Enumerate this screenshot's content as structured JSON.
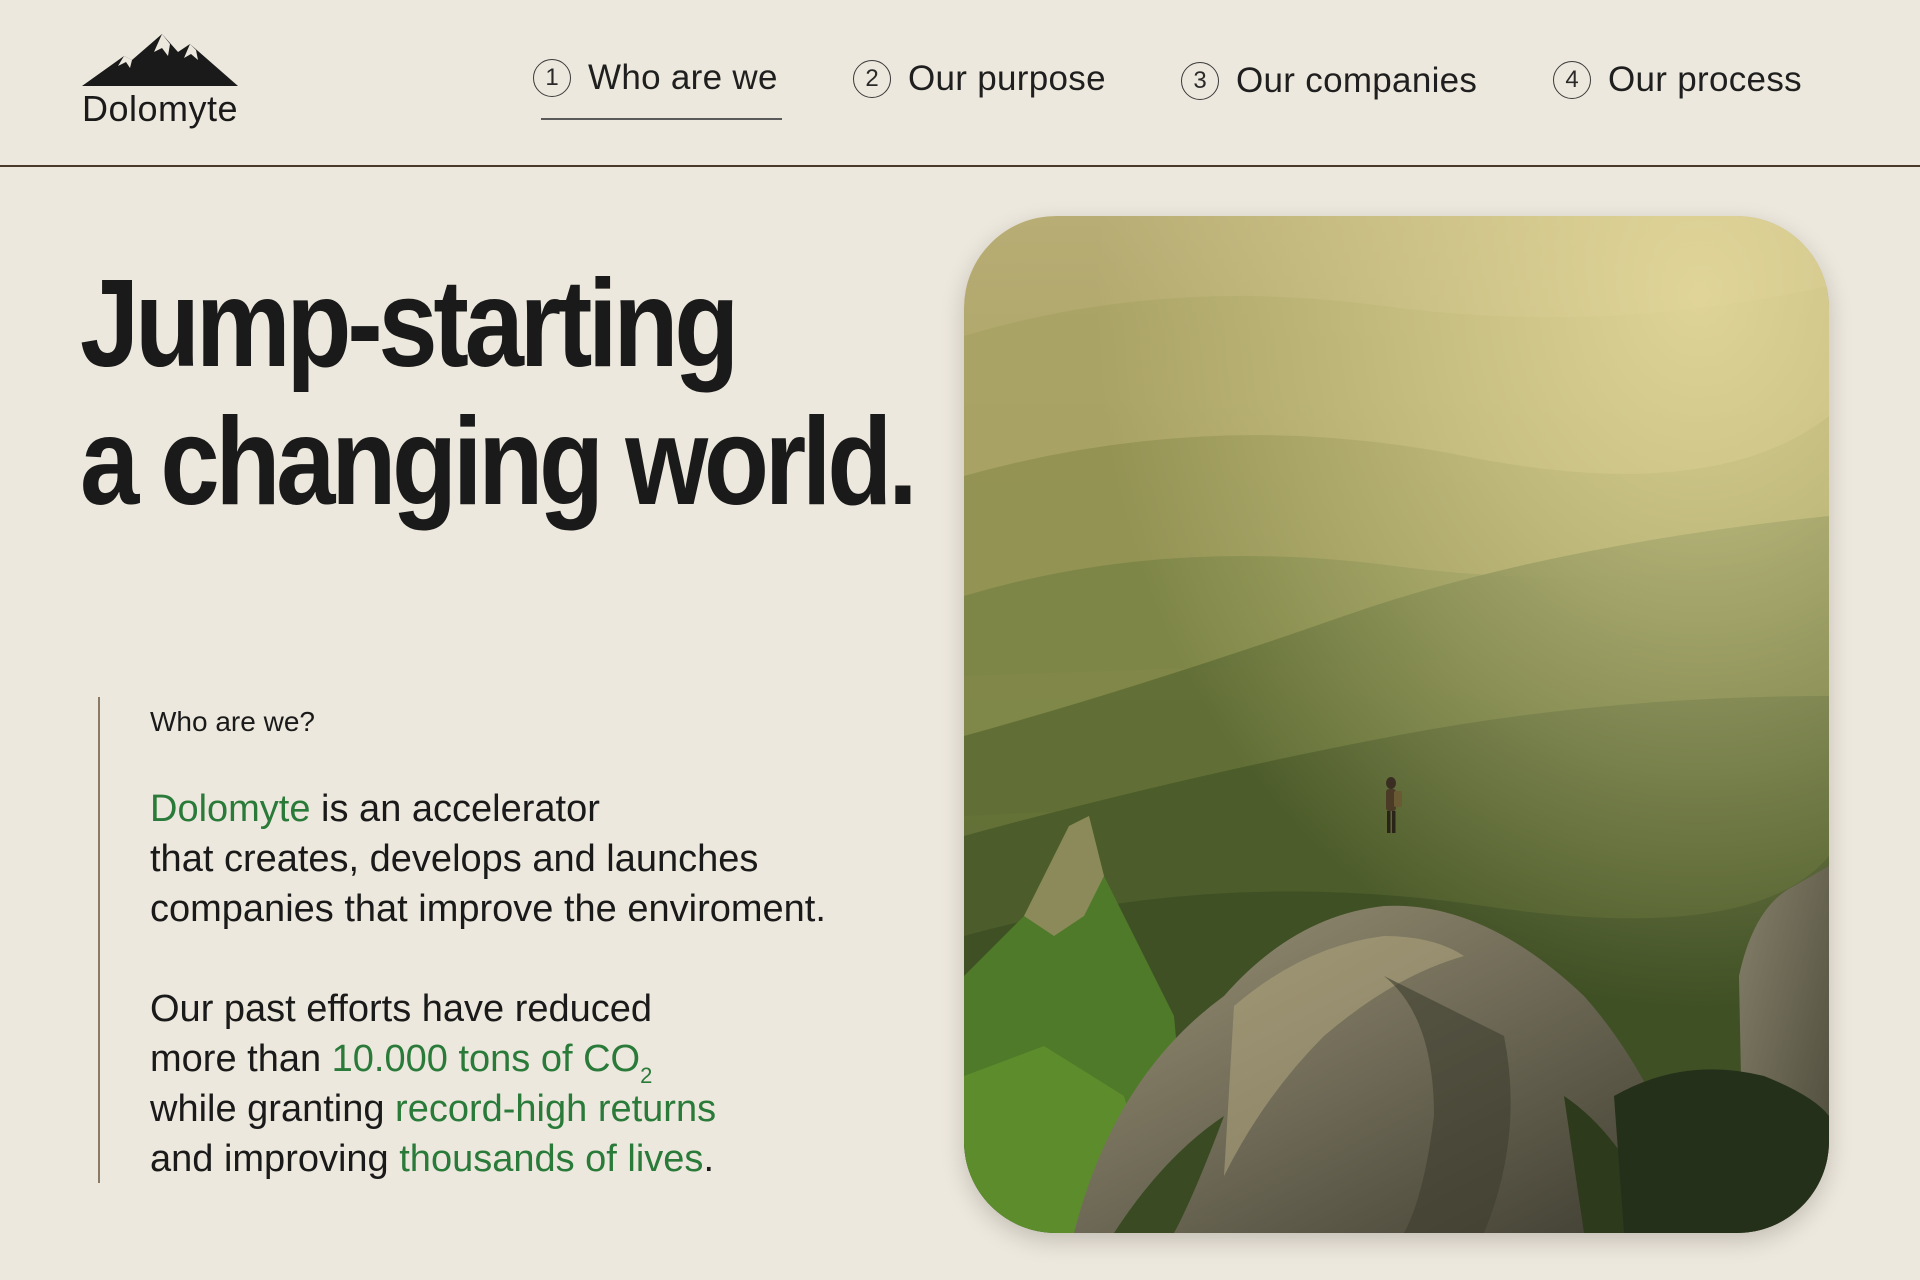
{
  "brand": {
    "name": "Dolomyte",
    "logo_icon": "mountain-logo-icon"
  },
  "nav": {
    "items": [
      {
        "number": "1",
        "label": "Who are we",
        "active": true
      },
      {
        "number": "2",
        "label": "Our purpose",
        "active": false
      },
      {
        "number": "3",
        "label": "Our companies",
        "active": false
      },
      {
        "number": "4",
        "label": "Our process",
        "active": false
      }
    ]
  },
  "hero": {
    "headline_line1": "Jump-starting",
    "headline_line2": "a changing world."
  },
  "info": {
    "label": "Who are we?",
    "p1_brand": "Dolomyte",
    "p1_line1_rest": " is an accelerator",
    "p1_line2": "that creates, develops and launches",
    "p1_line3": "companies that improve the enviroment.",
    "p2_line1": "Our past efforts have reduced",
    "p2_line2_prefix": "more than ",
    "p2_line2_highlight": "10.000 tons of CO",
    "p2_line2_subscript": "2",
    "p2_line3_prefix": "while granting ",
    "p2_line3_highlight": "record-high returns",
    "p2_line4_prefix": "and improving ",
    "p2_line4_highlight": "thousands of lives",
    "p2_line4_suffix": "."
  },
  "colors": {
    "background": "#ede8dd",
    "accent_green": "#2a7a3a",
    "text": "#1a1a1a",
    "divider": "#4a3a2c"
  },
  "image": {
    "subject": "hiker-on-mountain-peak-photo"
  }
}
